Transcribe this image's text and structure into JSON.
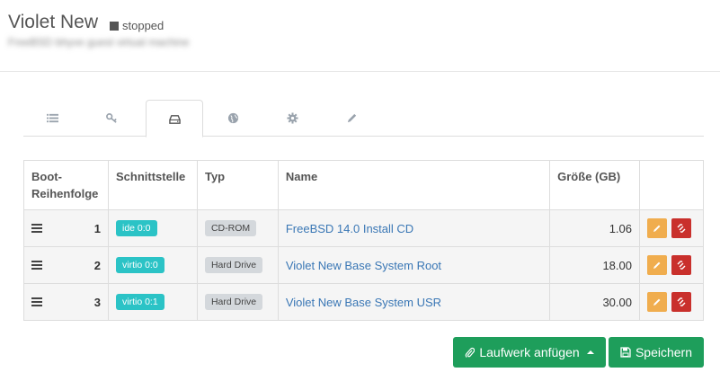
{
  "vm": {
    "title": "Violet New",
    "status": "stopped",
    "subtitle": "FreeBSD bhyve guest virtual machine"
  },
  "tabs": [
    {
      "icon": "list-icon"
    },
    {
      "icon": "key-icon"
    },
    {
      "icon": "hard-drive-icon",
      "active": true
    },
    {
      "icon": "globe-icon"
    },
    {
      "icon": "gear-icon"
    },
    {
      "icon": "pencil-icon"
    }
  ],
  "table": {
    "headers": [
      "Boot-\nReihenfolge",
      "Schnittstelle",
      "Typ",
      "Name",
      "Größe (GB)",
      ""
    ],
    "rows": [
      {
        "order": "1",
        "interface": "ide 0:0",
        "type": "CD-ROM",
        "name": "FreeBSD 14.0 Install CD",
        "size": "1.06"
      },
      {
        "order": "2",
        "interface": "virtio 0:0",
        "type": "Hard Drive",
        "name": "Violet New Base System Root",
        "size": "18.00"
      },
      {
        "order": "3",
        "interface": "virtio 0:1",
        "type": "Hard Drive",
        "name": "Violet New Base System USR",
        "size": "30.00"
      }
    ]
  },
  "buttons": {
    "add_drive": "Laufwerk anfügen",
    "save": "Speichern"
  },
  "colors": {
    "primary_green": "#1e9e5b",
    "interface_label": "#2bc3c6",
    "edit": "#f0ad4e",
    "delete": "#c9302c",
    "link": "#3a77b5"
  }
}
